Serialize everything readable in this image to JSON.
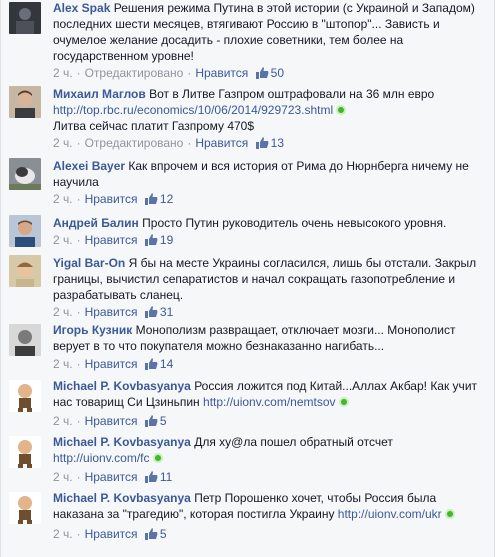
{
  "comments": [
    {
      "author": "Alex Spak",
      "text": "Решения режима Путина в этой истории (с Украиной и Западом) последних шести месяцев, втягивают Россию в \"штопор\"... Зависть и очумелое желание досадить - плохие советники, тем более на государственном уровне!",
      "time": "2 ч.",
      "edited": "Отредактировано",
      "like": "Нравится",
      "likes": "50"
    },
    {
      "author": "Михаил Маглов",
      "text": "Вот в Литве Газпром оштрафовали на 36 млн евро",
      "link": "http://top.rbc.ru/economics/10/06/2014/929723.shtml",
      "text2": "Литва сейчас платит Газпрому 470$",
      "time": "2 ч.",
      "edited": "Отредактировано",
      "like": "Нравится",
      "likes": "13"
    },
    {
      "author": "Alexei Bayer",
      "text": "Как впрочем и вся история от Рима до Нюрнберга ничему не научила",
      "time": "2 ч.",
      "like": "Нравится",
      "likes": "12"
    },
    {
      "author": "Андрей Балин",
      "text": "Просто Путин руководитель очень невысокого уровня.",
      "time": "2 ч.",
      "like": "Нравится",
      "likes": "19"
    },
    {
      "author": "Yigal Bar-On",
      "text": "Я бы на месте Украины согласился, лишь бы отстали. Закрыл границы, вычистил сепаратистов и начал сокращать газопотребление и разрабатывать сланец.",
      "time": "2 ч.",
      "like": "Нравится",
      "likes": "31"
    },
    {
      "author": "Игорь Кузник",
      "text": "Монополизм развращает, отключает мозги... Монополист верует в то что покупателя можно безнаказанно нагибать...",
      "time": "2 ч.",
      "like": "Нравится",
      "likes": "14"
    },
    {
      "author": "Michael P. Kovbasyanya",
      "text": "Россия ложится под Китай...Аллах Акбар! Как учит нас товарищ Си Цзиньпин",
      "link": "http://uionv.com/nemtsov",
      "time": "2 ч.",
      "like": "Нравится",
      "likes": "5"
    },
    {
      "author": "Michael P. Kovbasyanya",
      "text": "Для ху@ла пошел обратный отсчет",
      "link": "http://uionv.com/fc",
      "time": "2 ч.",
      "like": "Нравится",
      "likes": "11"
    },
    {
      "author": "Michael P. Kovbasyanya",
      "text": "Петр Порошенко хочет, чтобы Россия была наказана за \"трагедию\", которая постигла Украину",
      "link": "http://uionv.com/ukr",
      "time": "2 ч.",
      "like": "Нравится",
      "likes": "5"
    }
  ],
  "colors": {
    "link": "#3b5998",
    "meta": "#90949c",
    "background": "#f6f7f9"
  },
  "icons": [
    "like-icon",
    "verified-badge-icon"
  ]
}
